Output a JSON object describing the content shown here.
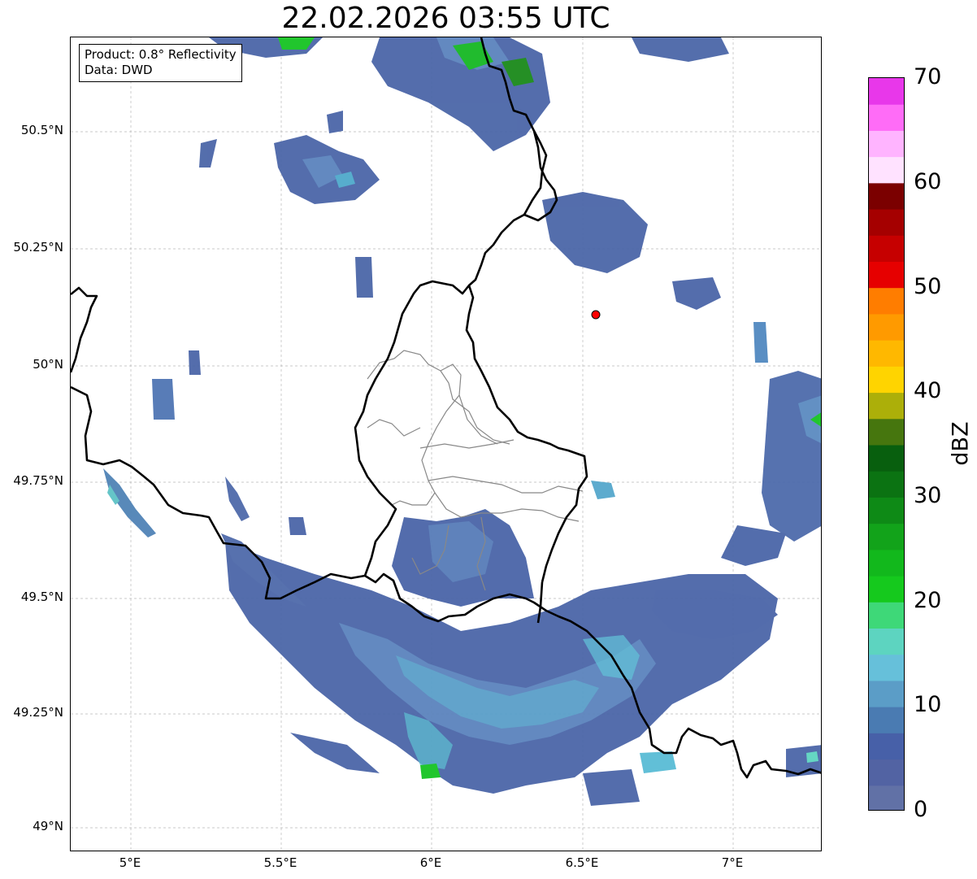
{
  "title": "22.02.2026 03:55 UTC",
  "info": {
    "product": "Product: 0.8° Reflectivity",
    "data_source": "Data: DWD"
  },
  "lat_labels": [
    "50.5°N",
    "50.25°N",
    "50°N",
    "49.75°N",
    "49.5°N",
    "49.25°N",
    "49°N"
  ],
  "lon_labels": [
    "5°E",
    "5.5°E",
    "6°E",
    "6.5°E",
    "7°E"
  ],
  "colorbar": {
    "label": "dBZ",
    "ticks": [
      "70",
      "60",
      "50",
      "40",
      "30",
      "20",
      "10",
      "0"
    ],
    "min": 0,
    "max": 70,
    "colors": [
      "#6171a6",
      "#5263a3",
      "#4760a8",
      "#4a7bb2",
      "#5b9dc7",
      "#66c0da",
      "#5dd4c0",
      "#3ed878",
      "#15c91d",
      "#12b81c",
      "#12a31a",
      "#0e8a16",
      "#0b7312",
      "#085f0e",
      "#46760e",
      "#acaf09",
      "#ffd400",
      "#ffb800",
      "#ff9a00",
      "#ff7d00",
      "#e60000",
      "#c60000",
      "#a50000",
      "#7b0000",
      "#ffe2ff",
      "#ffb4ff",
      "#ff6cf7",
      "#e837ea"
    ]
  },
  "radar_site": {
    "lon": 6.55,
    "lat": 50.11,
    "color": "#ff0000"
  },
  "map_extent": {
    "lon_min": 4.8,
    "lon_max": 7.3,
    "lat_min": 48.95,
    "lat_max": 50.7
  }
}
